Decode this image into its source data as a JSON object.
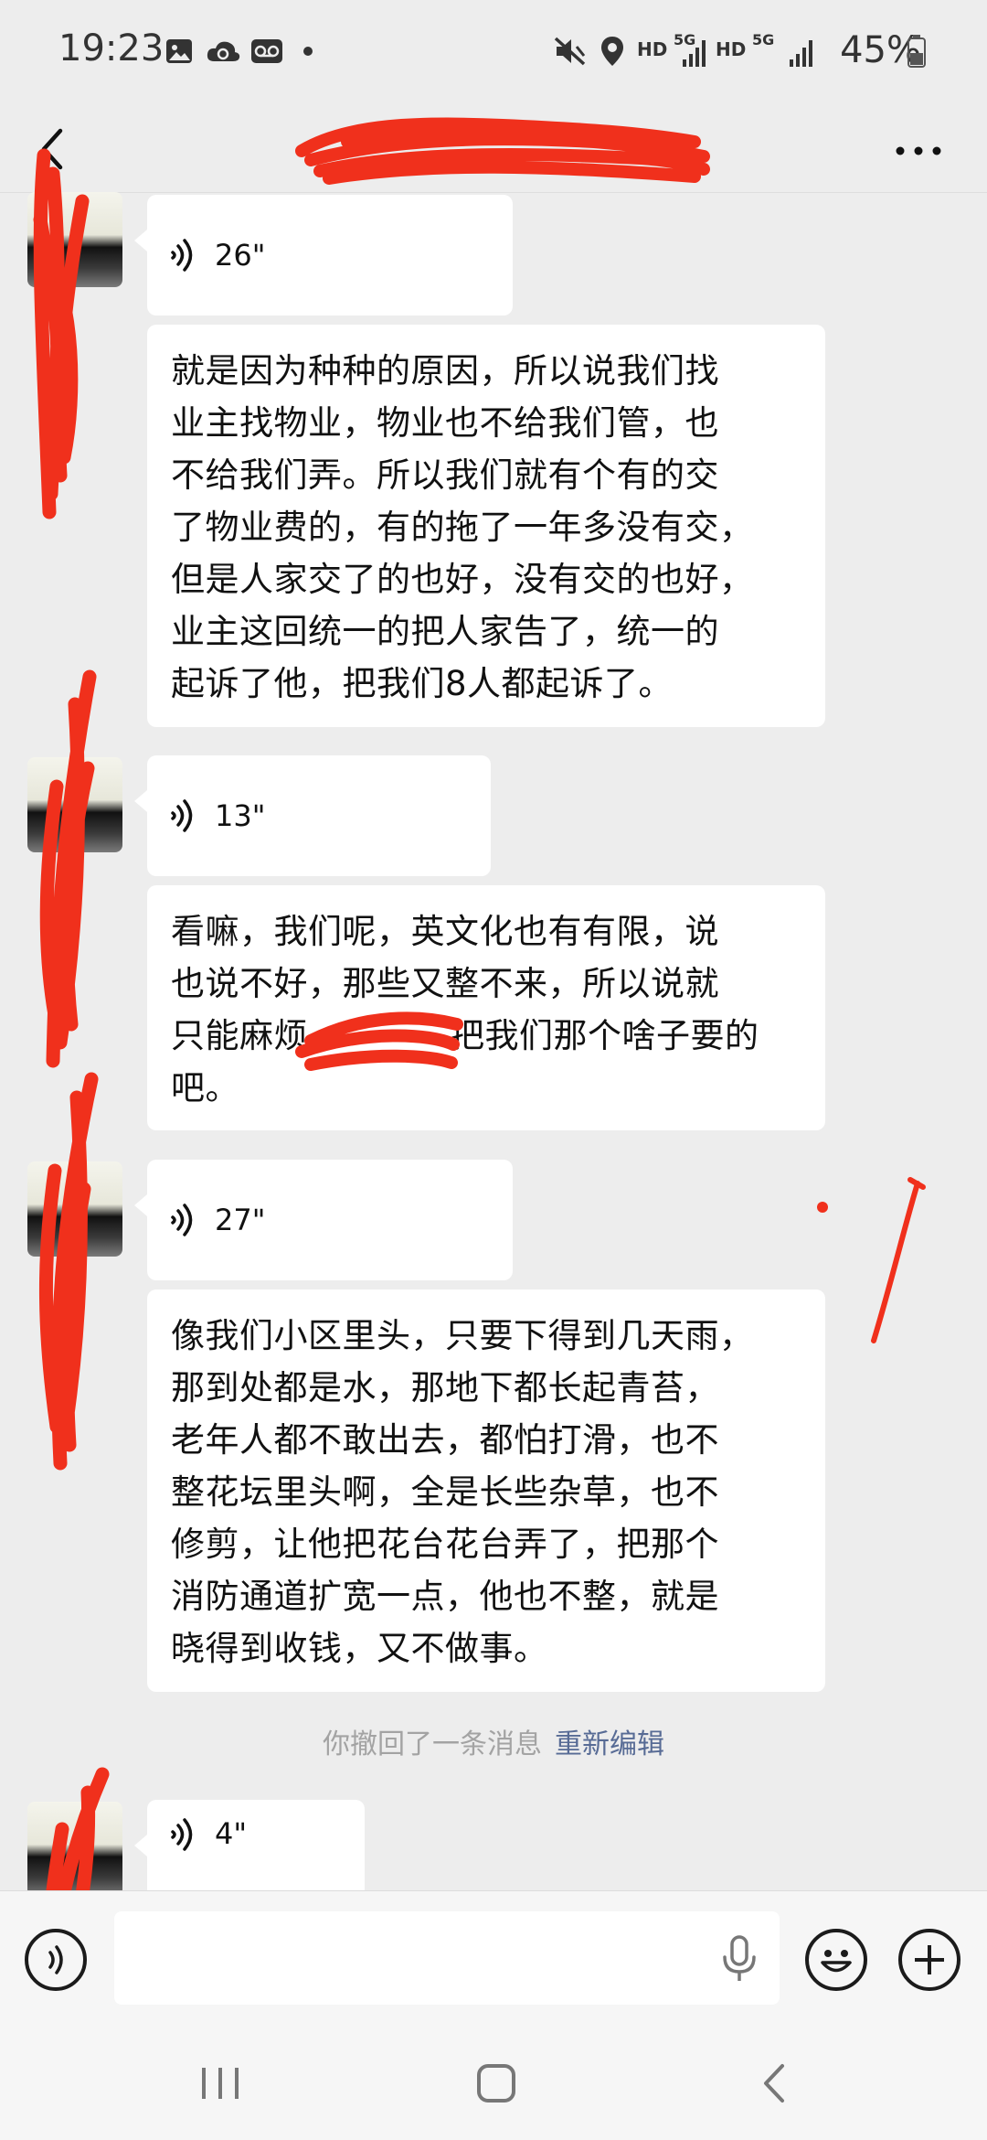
{
  "status_bar": {
    "time": "19:23",
    "network_labels": [
      "HD",
      "5G",
      "HD",
      "5G"
    ],
    "battery_percent": "45%"
  },
  "header": {
    "back_icon": "chevron-left-icon",
    "more_icon": "more-horizontal-icon"
  },
  "messages": [
    {
      "type": "voice",
      "duration": "26\""
    },
    {
      "type": "text",
      "lines": [
        "就是因为种种的原因，所以说我们找",
        "业主找物业，物业也不给我们管，也",
        "不给我们弄。所以我们就有个有的交",
        "了物业费的，有的拖了一年多没有交，",
        "但是人家交了的也好，没有交的也好，",
        "业主这回统一的把人家告了，统一的",
        "起诉了他，把我们8人都起诉了。"
      ]
    },
    {
      "type": "voice",
      "duration": "13\""
    },
    {
      "type": "text",
      "lines": [
        "看嘛，我们呢，英文化也有有限，说",
        "也说不好，那些又整不来，所以说就",
        "只能麻烦",
        "把我们那个啥子要的",
        "吧。"
      ]
    },
    {
      "type": "voice",
      "duration": "27\""
    },
    {
      "type": "text",
      "lines": [
        "像我们小区里头，只要下得到几天雨，",
        "那到处都是水，那地下都长起青苔，",
        "老年人都不敢出去，都怕打滑，也不",
        "整花坛里头啊，全是长些杂草，也不",
        "修剪，让他把花台花台弄了，把那个",
        "消防通道扩宽一点，他也不整，就是",
        "晓得到收钱，又不做事。"
      ]
    },
    {
      "type": "voice",
      "duration": "4\""
    }
  ],
  "recall_notice": {
    "text": "你撤回了一条消息",
    "action": "重新编辑"
  },
  "input_bar": {
    "voice_toggle_icon": "voice-toggle-icon",
    "mic_icon": "microphone-icon",
    "emoji_icon": "emoji-icon",
    "plus_icon": "plus-circle-icon"
  },
  "colors": {
    "background": "#ededed",
    "bubble": "#ffffff",
    "link": "#576b95",
    "redaction": "#f0301c"
  }
}
